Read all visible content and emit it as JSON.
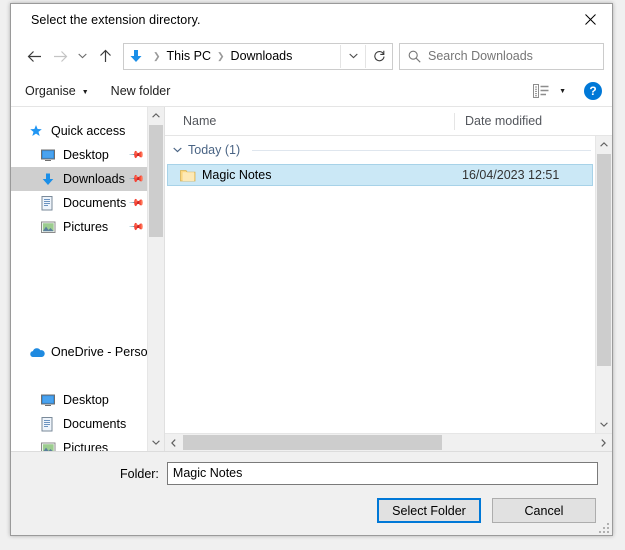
{
  "dialog": {
    "title": "Select the extension directory.",
    "close_label": "✕"
  },
  "nav": {
    "back_icon": "←",
    "forward_icon": "→",
    "recent_icon": "⌄",
    "up_icon": "↑",
    "separator": "❯",
    "breadcrumbs": [
      {
        "label": "This PC"
      },
      {
        "label": "Downloads"
      }
    ],
    "dropdown_icon": "⌄",
    "refresh_icon": "↻",
    "search": {
      "placeholder": "Search Downloads",
      "icon": "search-icon"
    }
  },
  "commandbar": {
    "organise_label": "Organise",
    "organise_caret": "▼",
    "new_folder_label": "New folder",
    "view_caret": "▼",
    "help_label": "?"
  },
  "sidebar": {
    "items": [
      {
        "label": "Quick access",
        "icon": "star-icon",
        "pinned": false,
        "indent": false,
        "selected": false
      },
      {
        "label": "Desktop",
        "icon": "monitor-icon",
        "pinned": true,
        "indent": true,
        "selected": false
      },
      {
        "label": "Downloads",
        "icon": "download-icon",
        "pinned": true,
        "indent": true,
        "selected": true
      },
      {
        "label": "Documents",
        "icon": "document-icon",
        "pinned": true,
        "indent": true,
        "selected": false
      },
      {
        "label": "Pictures",
        "icon": "picture-icon",
        "pinned": true,
        "indent": true,
        "selected": false
      },
      {
        "label": "OneDrive - Person",
        "icon": "cloud-icon",
        "pinned": false,
        "indent": false,
        "selected": false
      },
      {
        "label": "Desktop",
        "icon": "monitor-icon",
        "pinned": false,
        "indent": true,
        "selected": false
      },
      {
        "label": "Documents",
        "icon": "document-icon",
        "pinned": false,
        "indent": true,
        "selected": false
      },
      {
        "label": "Pictures",
        "icon": "picture-icon",
        "pinned": false,
        "indent": true,
        "selected": false
      }
    ]
  },
  "filelist": {
    "columns": {
      "name": "Name",
      "date_modified": "Date modified"
    },
    "group": {
      "label": "Today (1)",
      "chevron": "⌄"
    },
    "rows": [
      {
        "name": "Magic Notes",
        "date_modified": "16/04/2023 12:51",
        "icon": "folder-icon",
        "selected": true
      }
    ]
  },
  "scroll": {
    "up_arrow": "⌃",
    "down_arrow": "⌄",
    "left_arrow": "❮",
    "right_arrow": "❯"
  },
  "footer": {
    "folder_label": "Folder:",
    "folder_value": "Magic Notes",
    "folder_placeholder": "",
    "select_button": "Select Folder",
    "cancel_button": "Cancel"
  },
  "colors": {
    "accent": "#0078d7",
    "selection": "#cbe8f6",
    "sidebar_selection": "#cfcfcf",
    "group_text": "#4a6484",
    "folder_yellow": "#fcd77f"
  }
}
